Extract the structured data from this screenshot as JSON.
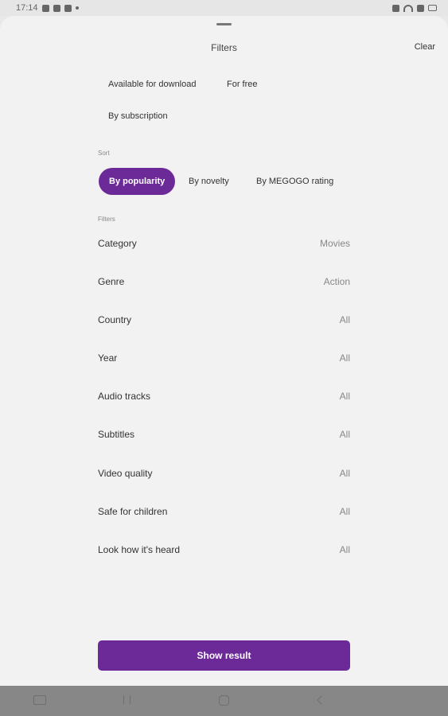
{
  "status_bar": {
    "time": "17:14",
    "left_icons": [
      "gallery-icon",
      "missed-call-icon",
      "shield-icon"
    ],
    "right_icons": [
      "mute-icon",
      "wifi-icon",
      "signal-icon",
      "battery-icon"
    ]
  },
  "header": {
    "title": "Filters",
    "clear_label": "Clear"
  },
  "availability": {
    "options": [
      "Available for download",
      "For free",
      "By subscription"
    ]
  },
  "sort": {
    "label": "Sort",
    "options": [
      "By popularity",
      "By novelty",
      "By MEGOGO rating"
    ],
    "selected": "By popularity"
  },
  "filters": {
    "label": "Filters",
    "rows": [
      {
        "label": "Category",
        "value": "Movies"
      },
      {
        "label": "Genre",
        "value": "Action"
      },
      {
        "label": "Country",
        "value": "All"
      },
      {
        "label": "Year",
        "value": "All"
      },
      {
        "label": "Audio tracks",
        "value": "All"
      },
      {
        "label": "Subtitles",
        "value": "All"
      },
      {
        "label": "Video quality",
        "value": "All"
      },
      {
        "label": "Safe for children",
        "value": "All"
      },
      {
        "label": "Look how it's heard",
        "value": "All"
      }
    ]
  },
  "footer": {
    "show_result_label": "Show result"
  },
  "colors": {
    "accent": "#6c2a99",
    "sheet_background": "#f2f2f2",
    "nav_bar": "#878787"
  },
  "nav_bar": {
    "icons": [
      "keyboard-icon",
      "recent-apps-icon",
      "home-icon",
      "back-icon"
    ]
  }
}
